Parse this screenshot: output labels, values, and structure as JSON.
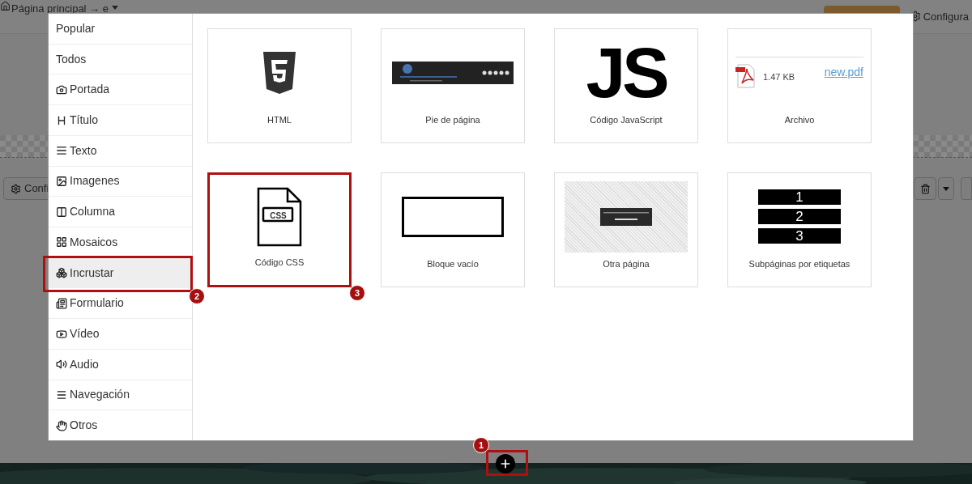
{
  "top_bar": {
    "breadcrumb": "Página principal → e",
    "settings": "Configura"
  },
  "toolbar": {
    "settings": "Confi"
  },
  "sidebar": {
    "items": [
      {
        "label": "Popular",
        "selected": false
      },
      {
        "label": "Todos",
        "selected": false
      },
      {
        "label": "Portada",
        "selected": false
      },
      {
        "label": "Título",
        "selected": false
      },
      {
        "label": "Texto",
        "selected": false
      },
      {
        "label": "Imagenes",
        "selected": false
      },
      {
        "label": "Columna",
        "selected": false
      },
      {
        "label": "Mosaicos",
        "selected": false
      },
      {
        "label": "Incrustar",
        "selected": true
      },
      {
        "label": "Formulario",
        "selected": false
      },
      {
        "label": "Vídeo",
        "selected": false
      },
      {
        "label": "Audio",
        "selected": false
      },
      {
        "label": "Navegación",
        "selected": false
      },
      {
        "label": "Otros",
        "selected": false
      }
    ]
  },
  "blocks": [
    {
      "kind": "html",
      "label": "HTML",
      "selected": false
    },
    {
      "kind": "footer",
      "label": "Pie de página",
      "selected": false
    },
    {
      "kind": "js",
      "label": "Código JavaScript",
      "glyph": "JS",
      "selected": false
    },
    {
      "kind": "file",
      "label": "Archivo",
      "size": "1.47 KB",
      "link": "new.pdf",
      "selected": false
    },
    {
      "kind": "css",
      "label": "Código CSS",
      "glyph": "CSS",
      "selected": true
    },
    {
      "kind": "empty",
      "label": "Bloque vacío",
      "selected": false
    },
    {
      "kind": "page",
      "label": "Otra página",
      "selected": false
    },
    {
      "kind": "tags",
      "label": "Subpáginas por etiquetas",
      "numbers": [
        "1",
        "2",
        "3"
      ],
      "selected": false
    }
  ],
  "annotations": [
    "1",
    "2",
    "3"
  ]
}
